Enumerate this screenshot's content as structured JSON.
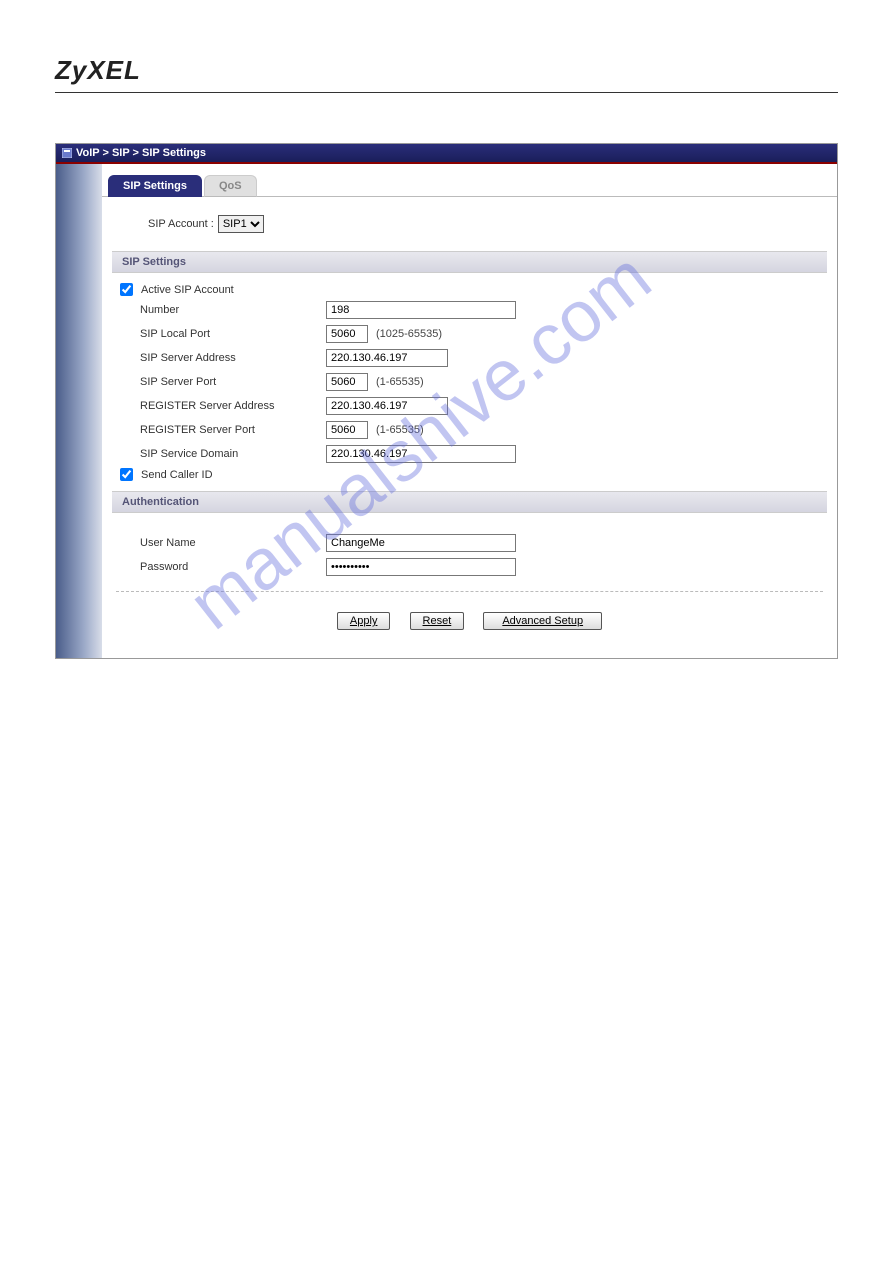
{
  "brand": "ZyXEL",
  "breadcrumb": "VoIP > SIP > SIP Settings",
  "tabs": {
    "active": "SIP Settings",
    "inactive": "QoS"
  },
  "sip_account": {
    "label": "SIP Account :",
    "value": "SIP1"
  },
  "sections": {
    "sip_settings": "SIP Settings",
    "authentication": "Authentication"
  },
  "fields": {
    "active_sip": {
      "label": "Active SIP Account",
      "checked": true
    },
    "number": {
      "label": "Number",
      "value": "198"
    },
    "local_port": {
      "label": "SIP Local Port",
      "value": "5060",
      "hint": "(1025-65535)"
    },
    "server_addr": {
      "label": "SIP Server Address",
      "value": "220.130.46.197"
    },
    "server_port": {
      "label": "SIP Server Port",
      "value": "5060",
      "hint": "(1-65535)"
    },
    "reg_addr": {
      "label": "REGISTER Server Address",
      "value": "220.130.46.197"
    },
    "reg_port": {
      "label": "REGISTER Server Port",
      "value": "5060",
      "hint": "(1-65535)"
    },
    "domain": {
      "label": "SIP Service Domain",
      "value": "220.130.46.197"
    },
    "caller_id": {
      "label": "Send Caller ID",
      "checked": true
    },
    "username": {
      "label": "User Name",
      "value": "ChangeMe"
    },
    "password": {
      "label": "Password",
      "value": "••••••••••"
    }
  },
  "buttons": {
    "apply": "Apply",
    "reset": "Reset",
    "advanced": "Advanced Setup"
  },
  "watermark": "manualshive.com"
}
